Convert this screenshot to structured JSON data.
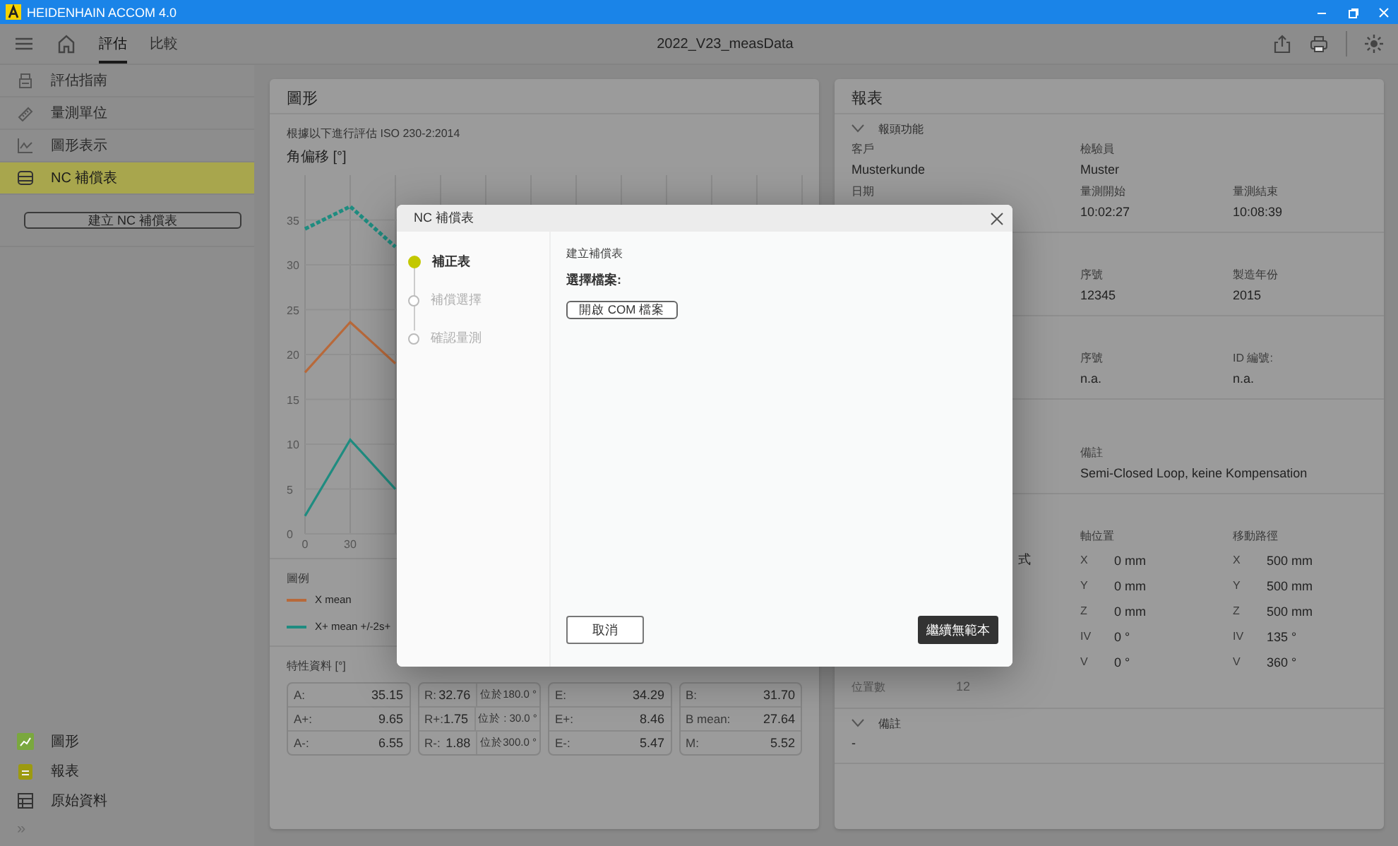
{
  "window": {
    "title": "HEIDENHAIN ACCOM 4.0"
  },
  "toolbar": {
    "tabs": [
      {
        "label": "評估",
        "selected": true
      },
      {
        "label": "比較",
        "selected": false
      }
    ],
    "file_name": "2022_V23_measData"
  },
  "sidebar": {
    "items": [
      {
        "label": "評估指南",
        "selected": false
      },
      {
        "label": "量測單位",
        "selected": false
      },
      {
        "label": "圖形表示",
        "selected": false
      },
      {
        "label": "NC 補償表",
        "selected": true
      }
    ],
    "button": "建立 NC 補償表",
    "views": [
      {
        "label": "圖形",
        "checked": true
      },
      {
        "label": "報表",
        "checked": true
      },
      {
        "label": "原始資料",
        "checked": false
      }
    ],
    "expand": "»"
  },
  "graph_panel": {
    "title": "圖形",
    "standard": "根據以下進行評估 ISO 230-2:2014",
    "chart_title": "角偏移 [°]",
    "chart_data": {
      "type": "line",
      "grid": true,
      "x": [
        0,
        30,
        60
      ],
      "xlim": [
        0,
        330
      ],
      "ylim": [
        0,
        40
      ],
      "xticks": [
        0,
        30
      ],
      "yticks": [
        0,
        5,
        10,
        15,
        20,
        25,
        30,
        35
      ],
      "series": [
        {
          "name": "X mean",
          "color": "#b8693a",
          "values": [
            18,
            23.6,
            19
          ]
        },
        {
          "name": "X+ mean +/-2s+",
          "color": "#1f8c80",
          "line_style": "dashed",
          "values": [
            34,
            36.5,
            32
          ]
        },
        {
          "color": "#1f8c80",
          "values": [
            2,
            10.5,
            5
          ]
        }
      ]
    },
    "legend": {
      "title": "圖例"
    },
    "characteristics": {
      "title": "特性資料 [°]",
      "tables": [
        [
          [
            "A:",
            "35.15"
          ],
          [
            "A+:",
            "9.65"
          ],
          [
            "A-:",
            "6.55"
          ]
        ],
        [
          [
            "R:",
            "32.76",
            "位於180.0 °"
          ],
          [
            "R+:",
            "1.75",
            "位於 : 30.0 °"
          ],
          [
            "R-:",
            "1.88",
            "位於300.0 °"
          ]
        ],
        [
          [
            "E:",
            "34.29"
          ],
          [
            "E+:",
            "8.46"
          ],
          [
            "E-:",
            "5.47"
          ]
        ],
        [
          [
            "B:",
            "31.70"
          ],
          [
            "B mean:",
            "27.64"
          ],
          [
            "M:",
            "5.52"
          ]
        ]
      ]
    }
  },
  "report_panel": {
    "title": "報表",
    "sections": [
      {
        "header": "報頭功能",
        "expanded": true,
        "rows": [
          {
            "kind": "label",
            "column_1": "客戶",
            "column_2": "檢驗員"
          },
          {
            "kind": "value",
            "column_1": "Musterkunde",
            "column_2": "Muster"
          },
          {
            "kind": "label",
            "column_1": "日期",
            "column_2": "量測開始",
            "column_3": "量測結束"
          },
          {
            "kind": "value",
            "column_2": "10:02:27",
            "column_3": "10:08:39"
          }
        ]
      },
      {
        "rows": [
          {
            "kind": "label",
            "column_2": "序號",
            "column_3": "製造年份"
          },
          {
            "kind": "value",
            "column_2": "12345",
            "column_3": "2015"
          }
        ]
      },
      {
        "rows": [
          {
            "kind": "label",
            "column_2": "序號",
            "column_3": "ID 編號:"
          },
          {
            "kind": "value",
            "column_2": "n.a.",
            "column_3": "n.a."
          }
        ]
      },
      {
        "rows": [
          {
            "kind": "label",
            "column_2": "備註"
          },
          {
            "kind": "value",
            "column_2": "Semi-Closed Loop, keine Kompensation"
          }
        ]
      },
      {
        "rows": [
          {
            "kind": "label",
            "column_2": "軸位置",
            "column_3": "移動路徑"
          },
          {
            "kind": "axis",
            "column_1": "式",
            "column_2": [
              "X",
              "0 mm"
            ],
            "column_3": [
              "X",
              "500 mm"
            ]
          },
          {
            "kind": "axis",
            "column_2": [
              "Y",
              "0 mm"
            ],
            "column_3": [
              "Y",
              "500 mm"
            ]
          },
          {
            "kind": "axis",
            "column_2": [
              "Z",
              "0 mm"
            ],
            "column_3": [
              "Z",
              "500 mm"
            ]
          },
          {
            "kind": "axis",
            "column_2": [
              "IV",
              "0 °"
            ],
            "column_3": [
              "IV",
              "135 °"
            ]
          },
          {
            "kind": "axis",
            "column_2": [
              "V",
              "0 °"
            ],
            "column_3": [
              "V",
              "360 °"
            ]
          },
          {
            "kind": "pair",
            "column_1": [
              "位置數",
              "12"
            ]
          }
        ]
      },
      {
        "header": "備註",
        "expanded": true,
        "rows": [
          {
            "kind": "value",
            "column_1": "-"
          }
        ]
      }
    ]
  },
  "dialog": {
    "title": "NC 補償表",
    "steps": [
      {
        "label": "補正表",
        "selected": true
      },
      {
        "label": "補償選擇",
        "selected": false
      },
      {
        "label": "確認量測",
        "selected": false
      }
    ],
    "heading": "建立補償表",
    "prompt": "選擇檔案:",
    "open_button": "開啟 COM 檔案",
    "cancel_button": "取消",
    "continue_button": "繼續無範本"
  }
}
